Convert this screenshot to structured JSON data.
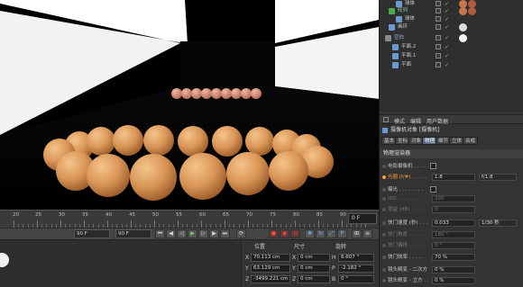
{
  "timeline": {
    "ticks": [
      "20",
      "25",
      "30",
      "35",
      "40",
      "45",
      "50",
      "55",
      "60",
      "65",
      "70",
      "75",
      "80",
      "85",
      "90"
    ],
    "current_frame": "0 F"
  },
  "transport": {
    "start_frame": "90 F",
    "end_frame": "90 F"
  },
  "coords": {
    "header_position": "位置",
    "header_size": "尺寸",
    "header_rotation": "旋转",
    "rows": [
      {
        "axis": "X",
        "pos": "70.113 cm",
        "size_axis": "X",
        "size": "0 cm",
        "rot_axis": "H",
        "rot": "6.607 °"
      },
      {
        "axis": "Y",
        "pos": "63.129 cm",
        "size_axis": "Y",
        "size": "0 cm",
        "rot_axis": "P",
        "rot": "-2.182 °"
      },
      {
        "axis": "Z",
        "pos": "-3499.221 cm",
        "size_axis": "Z",
        "size": "0 cm",
        "rot_axis": "B",
        "rot": "0 °"
      }
    ]
  },
  "objects": [
    {
      "name": "球体",
      "indent": 2
    },
    {
      "name": "阵列",
      "indent": 1
    },
    {
      "name": "球体",
      "indent": 2
    },
    {
      "name": "画环",
      "indent": 1
    },
    {
      "name": "空白",
      "indent": 1
    },
    {
      "name": "平面.2",
      "indent": 2
    },
    {
      "name": "平面.1",
      "indent": 2
    },
    {
      "name": "平面",
      "indent": 2
    }
  ],
  "attributes": {
    "menu": [
      "模式",
      "编辑",
      "用户数据"
    ],
    "title": "摄像机对象 [摄像机]",
    "tabs": [
      "基本",
      "坐标",
      "对象",
      "物理",
      "细节",
      "立体",
      "合成"
    ],
    "section": "物理渲染器",
    "props": [
      {
        "label": "电影摄像机 . . . . .",
        "value": "",
        "type": "check"
      },
      {
        "label": "光圈 (f/#) . . . . .",
        "value": "1.8",
        "dropdown": "f/1.8",
        "highlight": true
      },
      {
        "label": "曝光 . . . . . . . .",
        "value": "",
        "type": "check"
      },
      {
        "label": "ISO . . . . . . . .",
        "value": "200",
        "dim": true
      },
      {
        "label": "增益 (dB) . . . . .",
        "value": "0",
        "dim": true
      },
      {
        "label": "快门速度 (秒) . . .",
        "value": "0.033",
        "dropdown": "1/30 秒"
      },
      {
        "label": "快门角度 . . . . .",
        "value": "180 °",
        "dim": true
      },
      {
        "label": "快门偏移 . . . . .",
        "value": "0 °",
        "dim": true
      },
      {
        "label": "快门效率 . . . . .",
        "value": "70 %"
      },
      {
        "label": "镜头畸变 - 二次方",
        "value": "0 %"
      },
      {
        "label": "镜头畸变 - 立方 . .",
        "value": "0 %"
      }
    ]
  },
  "colors": {
    "accent_orange": "#ff9c3a",
    "tab_active": "#5a6a80",
    "sphere_fill": "#e0a060"
  }
}
